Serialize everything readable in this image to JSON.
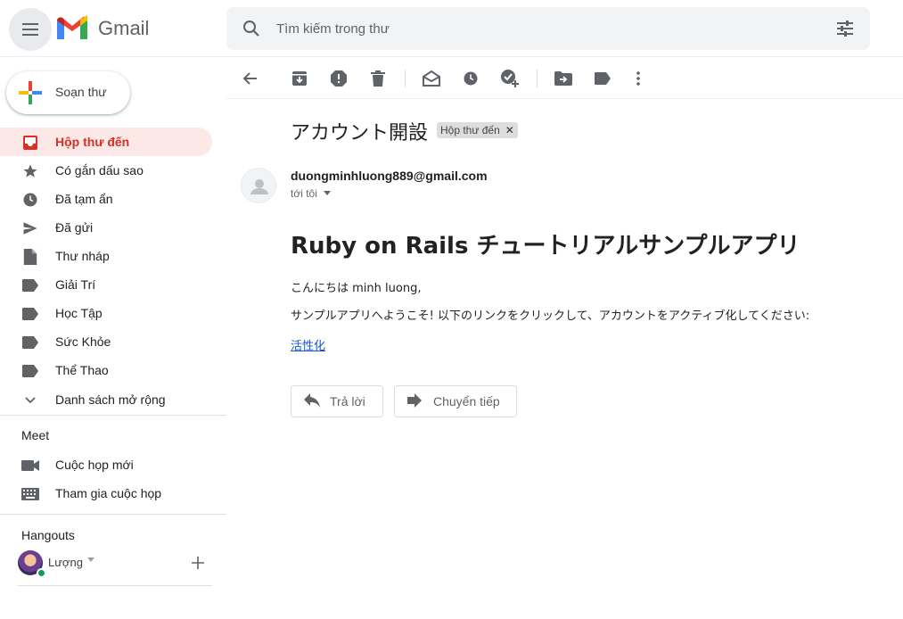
{
  "header": {
    "logo_text": "Gmail",
    "search_placeholder": "Tìm kiếm trong thư"
  },
  "sidebar": {
    "compose_label": "Soạn thư",
    "items": [
      {
        "label": "Hộp thư đến",
        "icon": "inbox-icon",
        "active": true
      },
      {
        "label": "Có gắn dấu sao",
        "icon": "star-icon"
      },
      {
        "label": "Đã tạm ẩn",
        "icon": "clock-icon"
      },
      {
        "label": "Đã gửi",
        "icon": "send-icon"
      },
      {
        "label": "Thư nháp",
        "icon": "draft-icon"
      },
      {
        "label": "Giải Trí",
        "icon": "label-icon"
      },
      {
        "label": "Học Tập",
        "icon": "label-icon"
      },
      {
        "label": "Sức Khỏe",
        "icon": "label-icon"
      },
      {
        "label": "Thể Thao",
        "icon": "label-icon"
      },
      {
        "label": "Danh sách mở rộng",
        "icon": "chevron-down-icon"
      }
    ],
    "meet": {
      "title": "Meet",
      "new_meeting": "Cuộc họp mới",
      "join_meeting": "Tham gia cuộc họp"
    },
    "hangouts": {
      "title": "Hangouts",
      "user_name": "Lượng"
    }
  },
  "message": {
    "subject": "アカウント開設",
    "label_chip": "Hộp thư đến",
    "sender_email": "duongminhluong889@gmail.com",
    "to_text": "tới tôi",
    "heading": "Ruby on Rails チュートリアルサンプルアプリ",
    "greeting": "こんにちは minh luong,",
    "body": "サンプルアプリへようこそ! 以下のリンクをクリックして、アカウントをアクティブ化してください:",
    "link_text": "活性化",
    "reply_label": "Trả lời",
    "forward_label": "Chuyển tiếp"
  },
  "colors": {
    "accent_red": "#d93025",
    "active_bg": "#fce8e6",
    "link": "#1155cc"
  }
}
